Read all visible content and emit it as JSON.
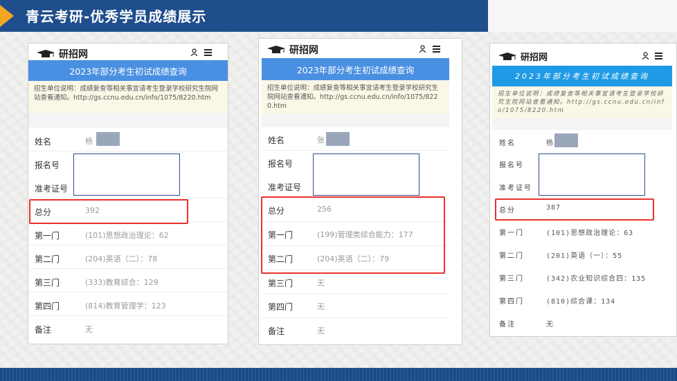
{
  "header": {
    "title": "青云考研-优秀学员成绩展示"
  },
  "colors": {
    "header_bg": "#1f4e8c",
    "accent": "#f4a623",
    "highlight": "#e8312a",
    "banner_1": "#4a90e2",
    "banner_3": "#1f9be6"
  },
  "phones": [
    {
      "brand": "研招网",
      "banner": "2023年部分考生初试成绩查询",
      "notice": "招生单位说明：成绩复查等相关事宜请考生登录学校研究生院网站查看通知。http://gs.ccnu.edu.cn/info/1075/8220.htm",
      "rows": [
        {
          "label": "姓名",
          "value": "杨"
        },
        {
          "label": "报名号",
          "value": ""
        },
        {
          "label": "准考证号",
          "value": ""
        },
        {
          "label": "总分",
          "value": "392"
        },
        {
          "label": "第一门",
          "value": "(101)思想政治理论：62"
        },
        {
          "label": "第二门",
          "value": "(204)英语（二）：78"
        },
        {
          "label": "第三门",
          "value": "(333)教育综合：129"
        },
        {
          "label": "第四门",
          "value": "(814)教育管理学：123"
        },
        {
          "label": "备注",
          "value": "无"
        }
      ]
    },
    {
      "brand": "研招网",
      "banner": "2023年部分考生初试成绩查询",
      "notice": "招生单位说明：成绩复查等相关事宜请考生登录学校研究生院网站查看通知。http://gs.ccnu.edu.cn/info/1075/8220.htm",
      "rows": [
        {
          "label": "姓名",
          "value": "张"
        },
        {
          "label": "报名号",
          "value": ""
        },
        {
          "label": "准考证号",
          "value": ""
        },
        {
          "label": "总分",
          "value": "256"
        },
        {
          "label": "第一门",
          "value": "(199)管理类综合能力：177"
        },
        {
          "label": "第二门",
          "value": "(204)英语（二）：79"
        },
        {
          "label": "第三门",
          "value": "无"
        },
        {
          "label": "第四门",
          "value": "无"
        },
        {
          "label": "备注",
          "value": "无"
        }
      ]
    },
    {
      "brand": "研招网",
      "banner": "2023年部分考生初试成绩查询",
      "notice": "招生单位说明：成绩复查等相关事宜请考生登录学校研究生院网站查看通知。http://gs.ccnu.edu.cn/info/1075/8220.htm",
      "rows": [
        {
          "label": "姓名",
          "value": "杨"
        },
        {
          "label": "报名号",
          "value": ""
        },
        {
          "label": "准考证号",
          "value": ""
        },
        {
          "label": "总分",
          "value": "387"
        },
        {
          "label": "第一门",
          "value": "(101)思想政治理论：63"
        },
        {
          "label": "第二门",
          "value": "(201)英语（一）：55"
        },
        {
          "label": "第三门",
          "value": "(342)农业知识综合四：135"
        },
        {
          "label": "第四门",
          "value": "(810)综合课：134"
        },
        {
          "label": "备注",
          "value": "无"
        }
      ]
    }
  ]
}
